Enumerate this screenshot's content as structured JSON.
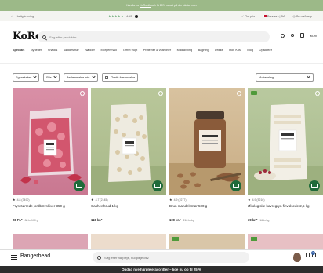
{
  "topbar": {
    "text_before": "Handla nu",
    "link": "KoRo.dk",
    "text_after": "och få 10% rabatt på din nästa order"
  },
  "infobar": {
    "left_text": "Hurtig levering",
    "trustpilot_rating": "4.6/5",
    "trustpilot_label": "★★★★★",
    "center_item": "Flot pris",
    "right_country": "Danmark | DA",
    "right_account": "Om os/hjælp"
  },
  "header": {
    "logo": "KoRo",
    "search_placeholder": "Søg efter produkter",
    "cart_label": "Kurv"
  },
  "nav": {
    "items": [
      "Specials",
      "Nyheder",
      "Snacks",
      "Nøddesmør",
      "Nødder",
      "Morgenmad",
      "Tørret frugt",
      "Proteiner & vitaminer",
      "Madlavning",
      "Bagning",
      "Drikke",
      "Hon Kost",
      "Blog",
      "Opskrifter"
    ]
  },
  "filters": {
    "items": [
      "Egenskaber",
      "Pris",
      "Bedømmelse min.",
      "Gratis forsendelse"
    ],
    "sort_label": "Anbefaling"
  },
  "products": [
    {
      "name": "Frysetørrede jordbærskiver 350 g",
      "rating": "4.8 (3490)",
      "price": "28 Fr.*",
      "unit": "88 kr/100 g"
    },
    {
      "name": "Cashewbrud 1 kg",
      "rating": "4.7 (2145)",
      "price": "110 kr.*",
      "unit": ""
    },
    {
      "name": "Brun mandelsmør 500 g",
      "rating": "4.9 (2277)",
      "price": "109 kr.*",
      "unit": "218 kr/kg"
    },
    {
      "name": "Økologiske havregryn finvalsede 2,5 kg",
      "rating": "4.9 (5216)",
      "price": "39 kr.*",
      "unit": "16 kr/kg"
    }
  ],
  "bottombar": {
    "brand": "Bangerhead",
    "search_placeholder": "Søg efter hårpleje, hudpleje osv.",
    "cart_count": "0"
  },
  "promo": {
    "text": "Opdag nye hårplejefavoritter – lige nu op til 25 %"
  },
  "colors": {
    "topbar": "#9cb988",
    "add_to_cart": "#1f6b3a",
    "promo_bar": "#2d2d2d"
  }
}
